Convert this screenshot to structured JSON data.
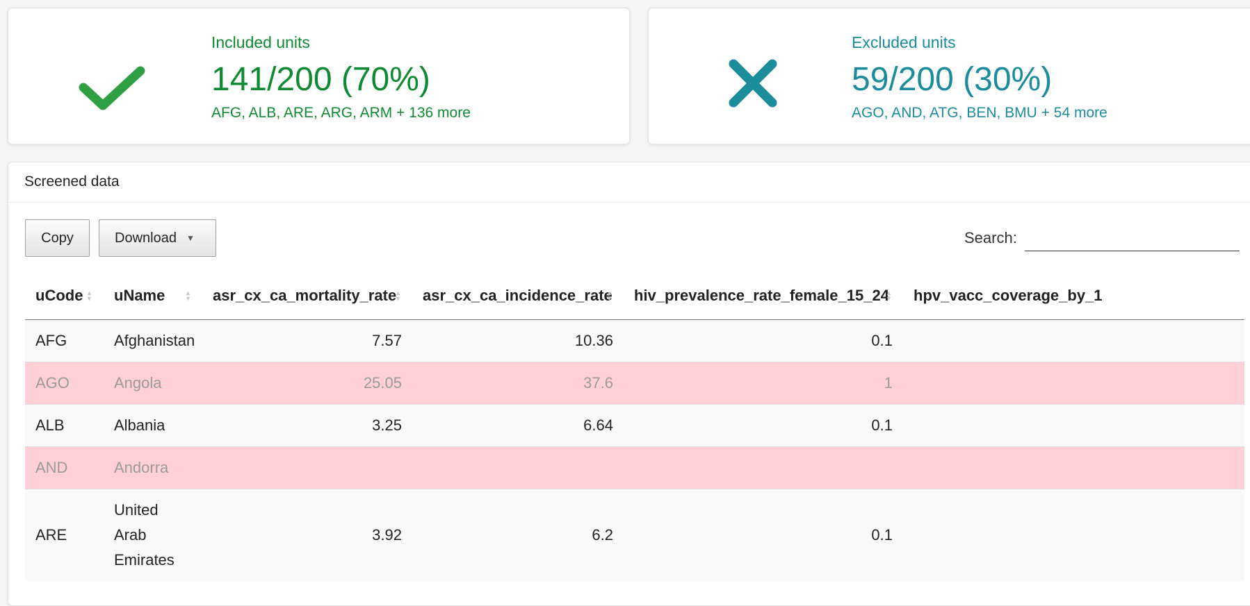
{
  "summary": {
    "included": {
      "label": "Included units",
      "value": "141/200 (70%)",
      "detail": "AFG, ALB, ARE, ARG, ARM + 136 more",
      "icon": "checkmark-icon",
      "color": "#0f8a32"
    },
    "excluded": {
      "label": "Excluded units",
      "value": "59/200 (30%)",
      "detail": "AGO, AND, ATG, BEN, BMU + 54 more",
      "icon": "cross-icon",
      "color": "#1a8c9c"
    }
  },
  "panel": {
    "title": "Screened data",
    "copy_label": "Copy",
    "download_label": "Download",
    "search_label": "Search:",
    "search_value": ""
  },
  "table": {
    "columns": [
      "uCode",
      "uName",
      "asr_cx_ca_mortality_rate",
      "asr_cx_ca_incidence_rate",
      "hiv_prevalence_rate_female_15_24",
      "hpv_vacc_coverage_by_1"
    ],
    "rows": [
      {
        "uCode": "AFG",
        "uName": "Afghanistan",
        "mortality": "7.57",
        "incidence": "10.36",
        "hiv": "0.1",
        "hpv": "",
        "excluded": false
      },
      {
        "uCode": "AGO",
        "uName": "Angola",
        "mortality": "25.05",
        "incidence": "37.6",
        "hiv": "1",
        "hpv": "",
        "excluded": true
      },
      {
        "uCode": "ALB",
        "uName": "Albania",
        "mortality": "3.25",
        "incidence": "6.64",
        "hiv": "0.1",
        "hpv": "",
        "excluded": false
      },
      {
        "uCode": "AND",
        "uName": "Andorra",
        "mortality": "",
        "incidence": "",
        "hiv": "",
        "hpv": "",
        "excluded": true
      },
      {
        "uCode": "ARE",
        "uName": "United Arab Emirates",
        "mortality": "3.92",
        "incidence": "6.2",
        "hiv": "0.1",
        "hpv": "",
        "excluded": false
      }
    ],
    "excluded_row_color": "#ffd0d8"
  }
}
